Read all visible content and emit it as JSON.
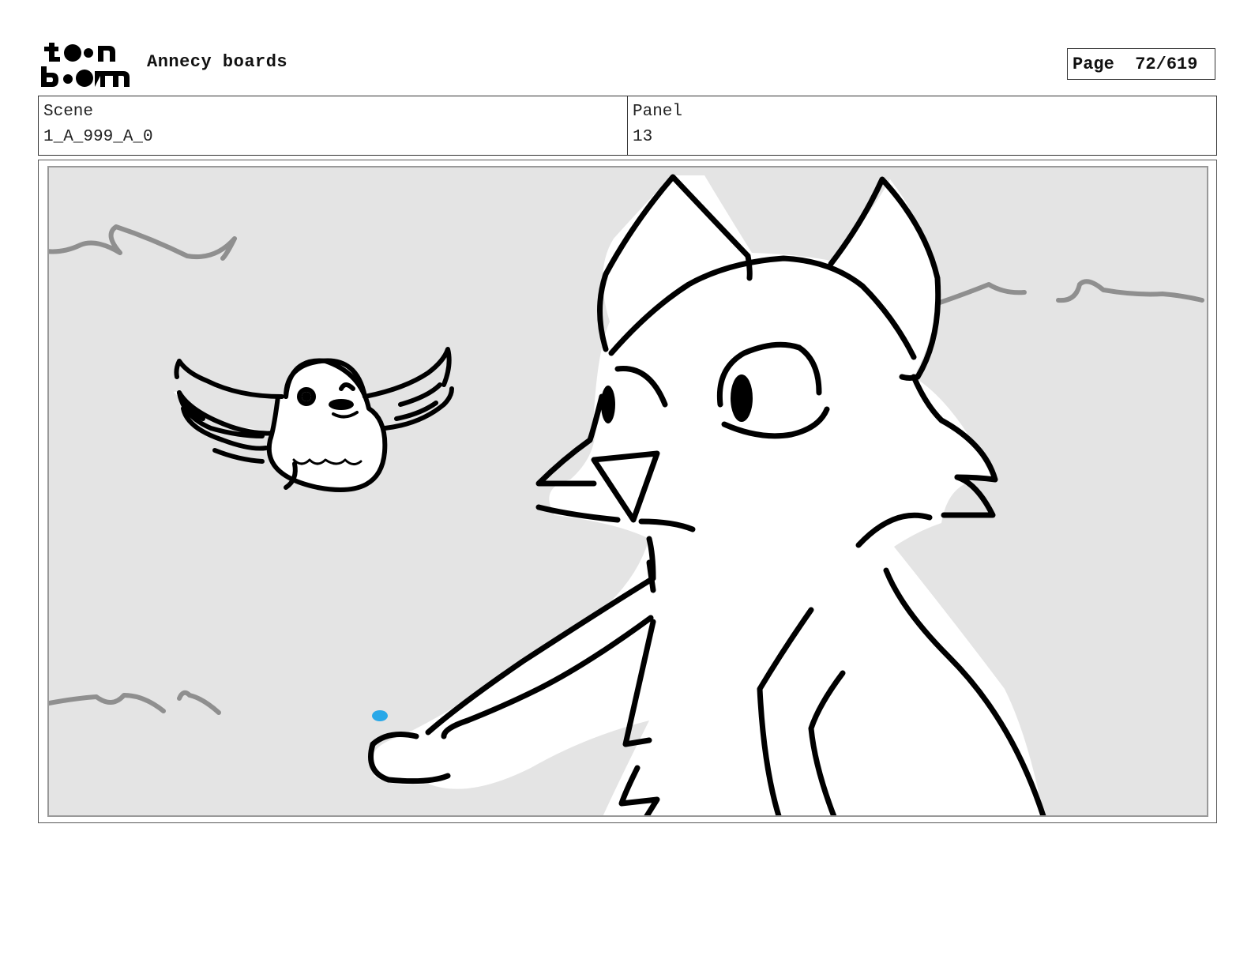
{
  "header": {
    "logo_text_top": "toon",
    "logo_text_bottom": "boom",
    "project_title": "Annecy boards",
    "page_label": "Page",
    "page_value": "72/619"
  },
  "info": {
    "scene_label": "Scene",
    "scene_value": "1_A_999_A_0",
    "panel_label": "Panel",
    "panel_value": "13"
  },
  "colors": {
    "panel_background": "#e4e4e4",
    "ink": "#000000",
    "grass_stroke": "#8f8f8f",
    "accent_dot": "#29a8e8"
  },
  "drawing": {
    "subjects": [
      "bird-icon",
      "fox-icon"
    ]
  }
}
